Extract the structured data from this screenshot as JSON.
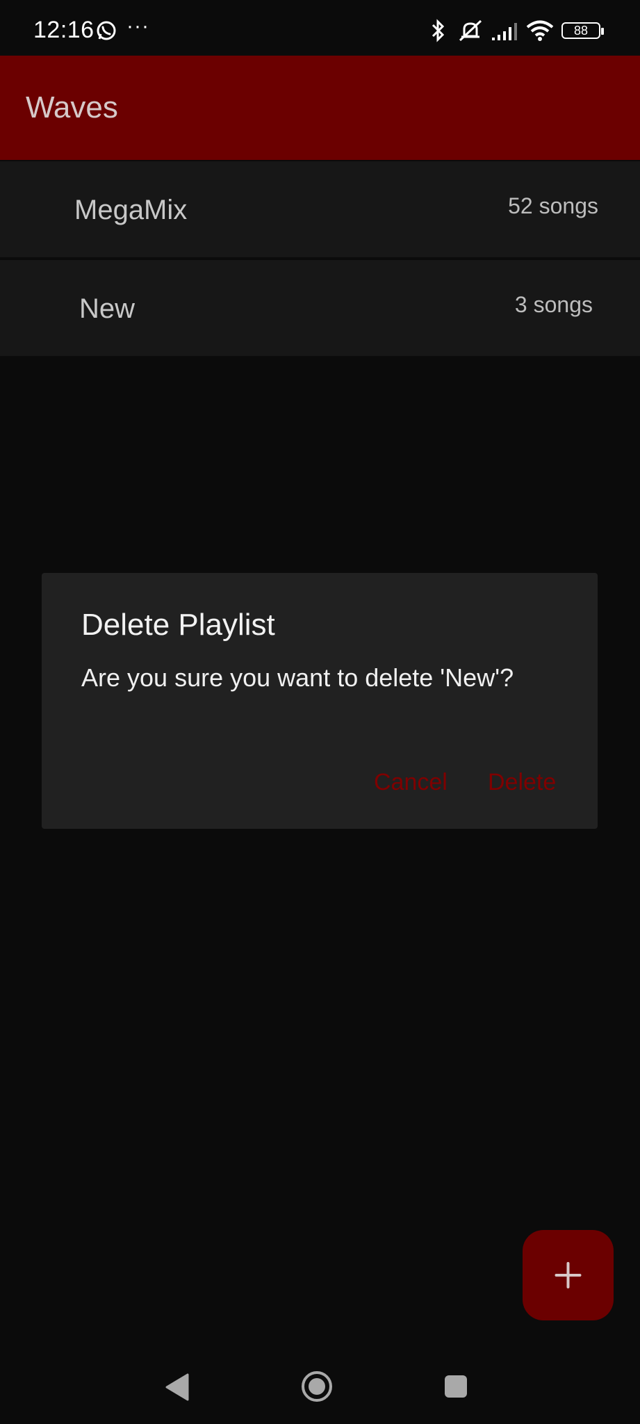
{
  "status_bar": {
    "time": "12:16",
    "more": "···",
    "battery": "88",
    "icons": [
      "whatsapp-icon",
      "bluetooth-icon",
      "mute-icon",
      "signal-icon",
      "wifi-icon",
      "battery-icon"
    ]
  },
  "app_bar": {
    "title": "Waves",
    "color": "#6b0000"
  },
  "playlists": [
    {
      "name": "MegaMix",
      "count": "52 songs"
    },
    {
      "name": "New",
      "count": "3 songs"
    }
  ],
  "dialog": {
    "title": "Delete Playlist",
    "message": "Are you sure you want to delete 'New'?",
    "cancel_label": "Cancel",
    "delete_label": "Delete",
    "button_color": "#7f0000"
  },
  "fab": {
    "icon": "plus-icon",
    "color": "#6b0000"
  },
  "nav_bar": {
    "icons": [
      "back-icon",
      "home-icon",
      "recents-icon"
    ]
  }
}
